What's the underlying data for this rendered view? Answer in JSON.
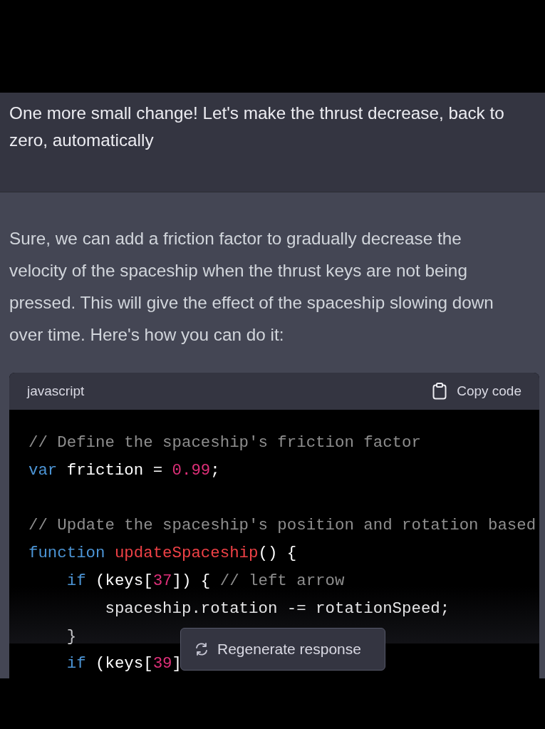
{
  "user_message": "One more small change! Let's make the thrust decrease, back to zero, automatically",
  "assistant_message": "Sure, we can add a friction factor to gradually decrease the velocity of the spaceship when the thrust keys are not being pressed. This will give the effect of the spaceship slowing down over time. Here's how you can do it:",
  "code_block": {
    "language": "javascript",
    "copy_label": "Copy code",
    "lines": [
      {
        "kind": "code",
        "tokens": [
          {
            "kind": "comment",
            "text": "// Define the spaceship's friction factor"
          }
        ]
      },
      {
        "kind": "code",
        "tokens": [
          {
            "kind": "keyword",
            "text": "var"
          },
          {
            "kind": "plain",
            "text": " friction = "
          },
          {
            "kind": "number",
            "text": "0.99"
          },
          {
            "kind": "plain",
            "text": ";"
          }
        ]
      },
      {
        "kind": "blank"
      },
      {
        "kind": "code",
        "tokens": [
          {
            "kind": "comment",
            "text": "// Update the spaceship's position and rotation based"
          }
        ]
      },
      {
        "kind": "code",
        "tokens": [
          {
            "kind": "keyword",
            "text": "function "
          },
          {
            "kind": "function",
            "text": "updateSpaceship"
          },
          {
            "kind": "plain",
            "text": "() {"
          }
        ]
      },
      {
        "kind": "code",
        "tokens": [
          {
            "kind": "keyword",
            "text": "    if"
          },
          {
            "kind": "plain",
            "text": " (keys["
          },
          {
            "kind": "number",
            "text": "37"
          },
          {
            "kind": "plain",
            "text": "]) { "
          },
          {
            "kind": "comment",
            "text": "// left arrow"
          }
        ]
      },
      {
        "kind": "code",
        "tokens": [
          {
            "kind": "plain",
            "text": "        spaceship.rotation -= rotationSpeed;"
          }
        ]
      },
      {
        "kind": "code",
        "tokens": [
          {
            "kind": "plain",
            "text": "    }"
          }
        ]
      },
      {
        "kind": "code",
        "tokens": [
          {
            "kind": "keyword",
            "text": "    if"
          },
          {
            "kind": "plain",
            "text": " (keys["
          },
          {
            "kind": "number",
            "text": "39"
          },
          {
            "kind": "plain",
            "text": "]"
          }
        ]
      }
    ]
  },
  "regenerate_button": "Regenerate response"
}
